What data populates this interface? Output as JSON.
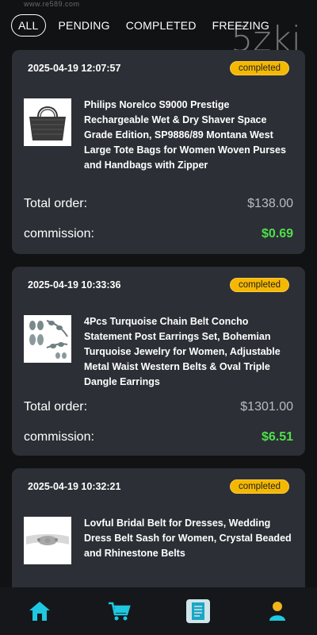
{
  "watermark": {
    "small": "www.re589.com",
    "big": "5zki"
  },
  "tabs": [
    {
      "label": "ALL",
      "active": true
    },
    {
      "label": "PENDING",
      "active": false
    },
    {
      "label": "COMPLETED",
      "active": false
    },
    {
      "label": "FREEZING",
      "active": false
    }
  ],
  "orders": [
    {
      "date": "2025-04-19 12:07:57",
      "status": "completed",
      "product": "Philips Norelco S9000 Prestige Rechargeable Wet & Dry Shaver Space Grade Edition, SP9886/89 Montana West Large Tote Bags for Women Woven Purses and Handbags with Zipper",
      "total_label": "Total order:",
      "total": "$138.00",
      "commission_label": "commission:",
      "commission": "$0.69"
    },
    {
      "date": "2025-04-19 10:33:36",
      "status": "completed",
      "product": "4Pcs Turquoise Chain Belt Concho Statement Post Earrings Set, Bohemian Turquoise Jewelry for Women, Adjustable Metal Waist Western Belts & Oval Triple Dangle Earrings",
      "total_label": "Total order:",
      "total": "$1301.00",
      "commission_label": "commission:",
      "commission": "$6.51"
    },
    {
      "date": "2025-04-19 10:32:21",
      "status": "completed",
      "product": "Lovful Bridal Belt for Dresses, Wedding Dress Belt Sash for Women, Crystal Beaded and Rhinestone Belts"
    }
  ],
  "colors": {
    "background": "#111214",
    "card": "#2c2f35",
    "badge": "#f5b800",
    "commission": "#4ee04a",
    "nav_icon": "#1ec8e0"
  },
  "nav": [
    {
      "icon": "home-icon"
    },
    {
      "icon": "cart-icon"
    },
    {
      "icon": "orders-icon"
    },
    {
      "icon": "profile-icon"
    }
  ]
}
